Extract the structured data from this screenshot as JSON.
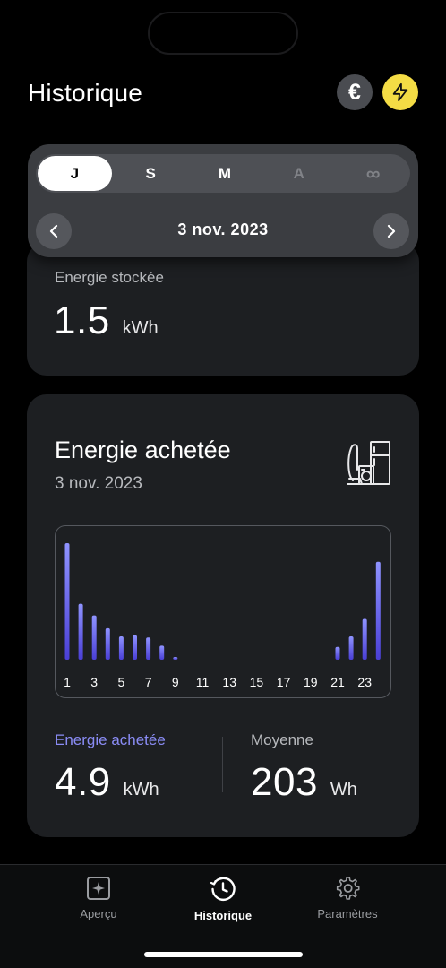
{
  "header": {
    "title": "Historique"
  },
  "header_buttons": {
    "currency_icon": "euro-icon",
    "energy_icon": "bolt-icon"
  },
  "selector": {
    "segments": [
      "J",
      "S",
      "M",
      "A",
      "∞"
    ],
    "active_index": 0,
    "date": "3 nov. 2023"
  },
  "stored": {
    "label": "Energie stockée",
    "value": "1.5",
    "unit": "kWh"
  },
  "bought": {
    "title": "Energie achetée",
    "date": "3 nov. 2023",
    "stats": {
      "left_label": "Energie achetée",
      "left_value": "4.9",
      "left_unit": "kWh",
      "right_label": "Moyenne",
      "right_value": "203",
      "right_unit": "Wh"
    }
  },
  "chart_data": {
    "type": "bar",
    "categories": [
      1,
      2,
      3,
      4,
      5,
      6,
      7,
      8,
      9,
      10,
      11,
      12,
      13,
      14,
      15,
      16,
      17,
      18,
      19,
      20,
      21,
      22,
      23,
      24
    ],
    "tick_labels": [
      "1",
      "3",
      "5",
      "7",
      "9",
      "11",
      "13",
      "15",
      "17",
      "19",
      "21",
      "23"
    ],
    "values": [
      100,
      48,
      38,
      27,
      20,
      21,
      19,
      12,
      2,
      0,
      0,
      0,
      0,
      0,
      0,
      0,
      0,
      0,
      0,
      0,
      11,
      20,
      35,
      84
    ],
    "xlabel": "",
    "ylabel": "",
    "colors": {
      "bar_top": "#8f93ff",
      "bar_bottom": "#4a3fd6"
    }
  },
  "tabbar": {
    "items": [
      {
        "label": "Aperçu",
        "icon": "dashboard-icon"
      },
      {
        "label": "Historique",
        "icon": "history-icon"
      },
      {
        "label": "Paramètres",
        "icon": "gear-icon"
      }
    ]
  }
}
